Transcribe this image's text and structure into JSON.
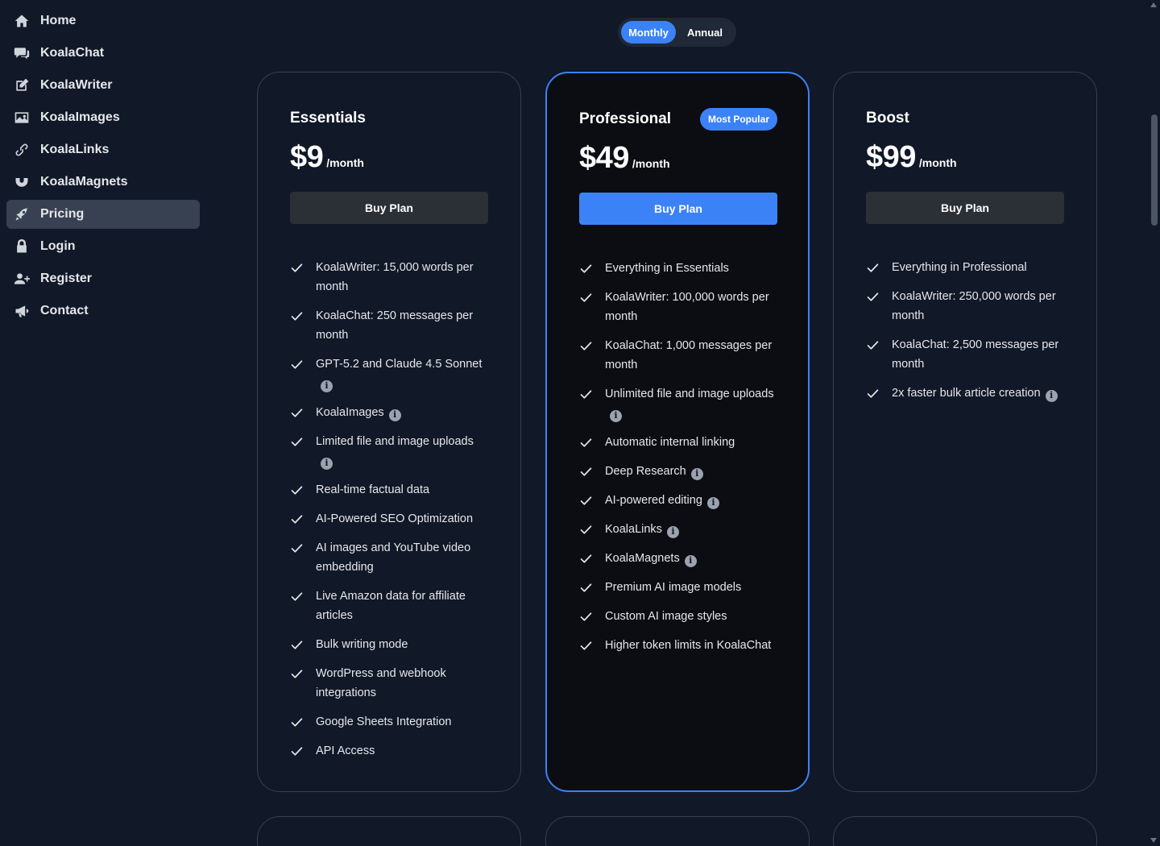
{
  "sidebar": {
    "items": [
      {
        "label": "Home",
        "icon": "home-icon",
        "active": false
      },
      {
        "label": "KoalaChat",
        "icon": "chat-icon",
        "active": false
      },
      {
        "label": "KoalaWriter",
        "icon": "edit-icon",
        "active": false
      },
      {
        "label": "KoalaImages",
        "icon": "image-icon",
        "active": false
      },
      {
        "label": "KoalaLinks",
        "icon": "link-icon",
        "active": false
      },
      {
        "label": "KoalaMagnets",
        "icon": "magnet-icon",
        "active": false
      },
      {
        "label": "Pricing",
        "icon": "rocket-icon",
        "active": true
      },
      {
        "label": "Login",
        "icon": "lock-icon",
        "active": false
      },
      {
        "label": "Register",
        "icon": "user-plus-icon",
        "active": false
      },
      {
        "label": "Contact",
        "icon": "megaphone-icon",
        "active": false
      }
    ]
  },
  "billing_toggle": {
    "monthly": "Monthly",
    "annual": "Annual",
    "selected": "Monthly"
  },
  "colors": {
    "accent": "#3b82f6",
    "background": "#111827"
  },
  "plans": [
    {
      "name": "Essentials",
      "price": "$9",
      "period": "/month",
      "button": "Buy Plan",
      "features": [
        {
          "text": "KoalaWriter: 15,000 words per month",
          "info": false
        },
        {
          "text": "KoalaChat: 250 messages per month",
          "info": false
        },
        {
          "text": "GPT-5.2 and Claude 4.5 Sonnet",
          "info": true
        },
        {
          "text": "KoalaImages",
          "info": true
        },
        {
          "text": "Limited file and image uploads",
          "info": true
        },
        {
          "text": "Real-time factual data",
          "info": false
        },
        {
          "text": "AI-Powered SEO Optimization",
          "info": false
        },
        {
          "text": "AI images and YouTube video embedding",
          "info": false
        },
        {
          "text": "Live Amazon data for affiliate articles",
          "info": false
        },
        {
          "text": "Bulk writing mode",
          "info": false
        },
        {
          "text": "WordPress and webhook integrations",
          "info": false
        },
        {
          "text": "Google Sheets Integration",
          "info": false
        },
        {
          "text": "API Access",
          "info": false
        }
      ]
    },
    {
      "name": "Professional",
      "badge": "Most Popular",
      "price": "$49",
      "period": "/month",
      "button": "Buy Plan",
      "features": [
        {
          "text": "Everything in Essentials",
          "info": false
        },
        {
          "text": "KoalaWriter: 100,000 words per month",
          "info": false
        },
        {
          "text": "KoalaChat: 1,000 messages per month",
          "info": false
        },
        {
          "text": "Unlimited file and image uploads",
          "info": true
        },
        {
          "text": "Automatic internal linking",
          "info": false
        },
        {
          "text": "Deep Research",
          "info": true
        },
        {
          "text": "AI-powered editing",
          "info": true
        },
        {
          "text": "KoalaLinks",
          "info": true
        },
        {
          "text": "KoalaMagnets",
          "info": true
        },
        {
          "text": "Premium AI image models",
          "info": false
        },
        {
          "text": "Custom AI image styles",
          "info": false
        },
        {
          "text": "Higher token limits in KoalaChat",
          "info": false
        }
      ]
    },
    {
      "name": "Boost",
      "price": "$99",
      "period": "/month",
      "button": "Buy Plan",
      "features": [
        {
          "text": "Everything in Professional",
          "info": false
        },
        {
          "text": "KoalaWriter: 250,000 words per month",
          "info": false
        },
        {
          "text": "KoalaChat: 2,500 messages per month",
          "info": false
        },
        {
          "text": "2x faster bulk article creation",
          "info": true
        }
      ]
    }
  ]
}
